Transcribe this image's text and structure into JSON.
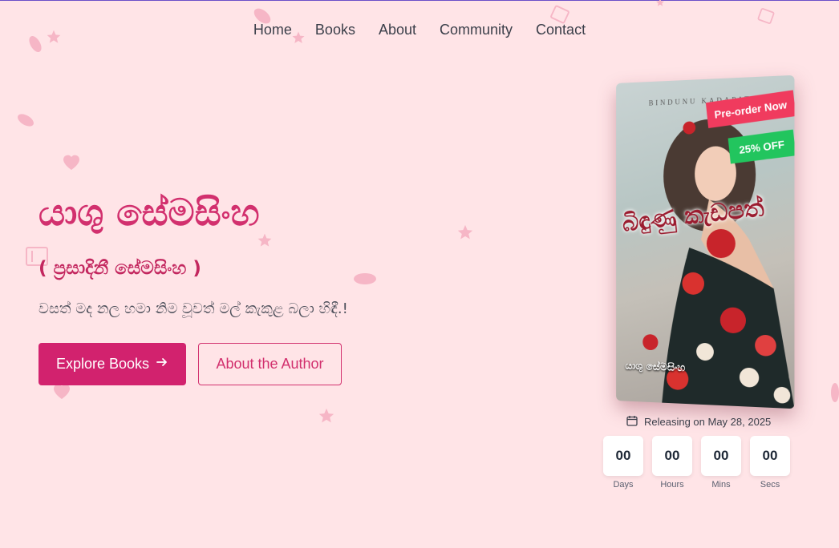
{
  "nav": {
    "items": [
      "Home",
      "Books",
      "About",
      "Community",
      "Contact"
    ]
  },
  "hero": {
    "title": "යාශු සේමසිංහ",
    "subtitle": "( ප්‍රසාදිනී සේමසිංහ )",
    "tagline": "වසත් මද නල හමා නිම වූවත් මල් කැකුළ බලා හිඳී.!",
    "primary_button": "Explore Books",
    "secondary_button": "About the Author"
  },
  "book": {
    "top_text": "BINDUNU KADAPATH",
    "title_art": "බිඳුණු කැඩපත්",
    "author_on_cover": "යාශු සේමසිංහ",
    "badge_preorder": "Pre-order Now",
    "badge_discount": "25% OFF"
  },
  "release": {
    "text": "Releasing on May 28, 2025",
    "icon": "calendar-icon"
  },
  "countdown": [
    {
      "value": "00",
      "label": "Days"
    },
    {
      "value": "00",
      "label": "Hours"
    },
    {
      "value": "00",
      "label": "Mins"
    },
    {
      "value": "00",
      "label": "Secs"
    }
  ],
  "colors": {
    "background": "#ffe4e7",
    "accent": "#d2226e",
    "ribbon_red": "#f03b5e",
    "ribbon_green": "#22c55e"
  }
}
